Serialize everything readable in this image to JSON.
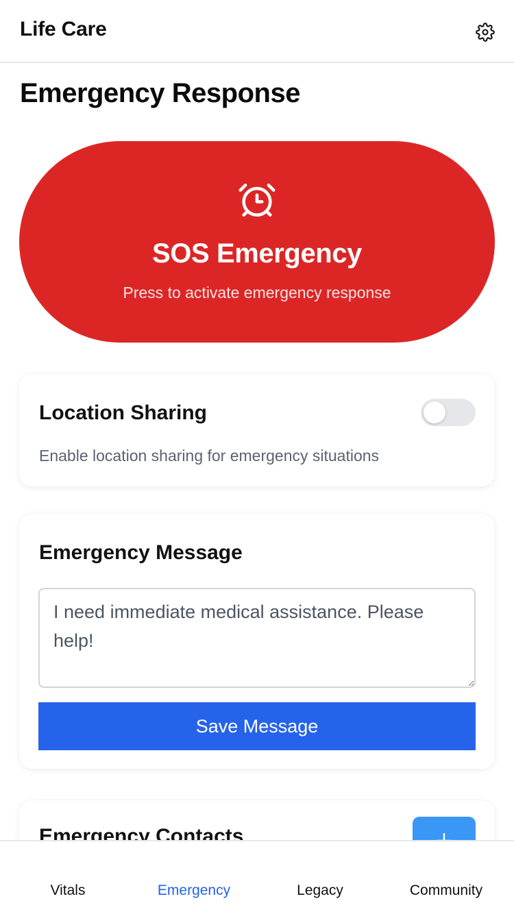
{
  "header": {
    "app_title": "Life Care",
    "settings_icon": "gear-icon"
  },
  "page": {
    "title": "Emergency Response"
  },
  "sos": {
    "icon": "alarm-clock-icon",
    "title": "SOS Emergency",
    "subtitle": "Press to activate emergency response",
    "color": "#dc2626"
  },
  "location_sharing": {
    "title": "Location Sharing",
    "description": "Enable location sharing for emergency situations",
    "enabled": false
  },
  "emergency_message": {
    "title": "Emergency Message",
    "value": "I need immediate medical assistance. Please help!",
    "save_label": "Save Message",
    "button_color": "#2563eb"
  },
  "emergency_contacts": {
    "title": "Emergency Contacts",
    "add_icon": "plus-icon"
  },
  "nav": {
    "items": [
      {
        "label": "Vitals",
        "active": false
      },
      {
        "label": "Emergency",
        "active": true
      },
      {
        "label": "Legacy",
        "active": false
      },
      {
        "label": "Community",
        "active": false
      }
    ],
    "active_color": "#2563eb"
  }
}
